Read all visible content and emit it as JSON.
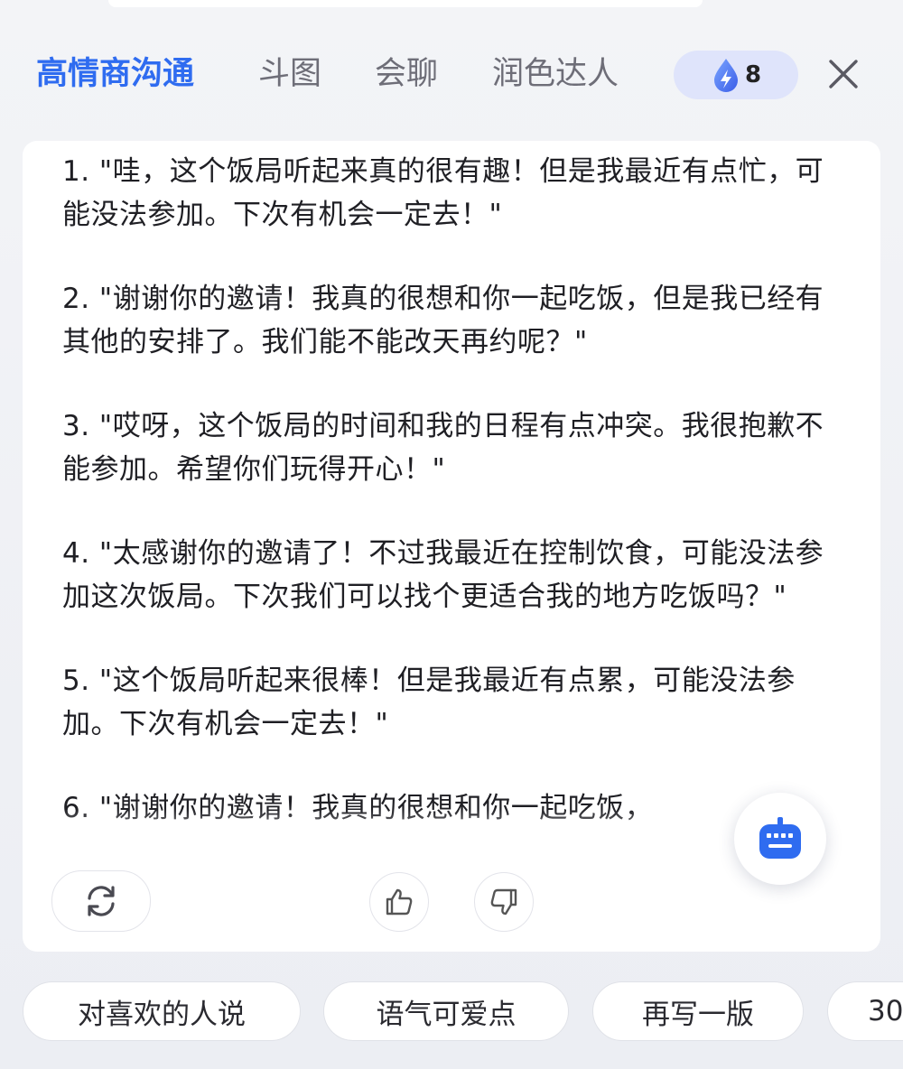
{
  "tabs": [
    {
      "label": "高情商沟通",
      "active": true
    },
    {
      "label": "斗图",
      "active": false
    },
    {
      "label": "会聊",
      "active": false
    },
    {
      "label": "润色达人",
      "active": false
    }
  ],
  "energy": {
    "icon": "lightning-drop-icon",
    "count": "8"
  },
  "close": {
    "icon": "close-icon"
  },
  "replies": [
    "1. \"哇，这个饭局听起来真的很有趣！但是我最近有点忙，可能没法参加。下次有机会一定去！\"",
    "2. \"谢谢你的邀请！我真的很想和你一起吃饭，但是我已经有其他的安排了。我们能不能改天再约呢？\"",
    "3. \"哎呀，这个饭局的时间和我的日程有点冲突。我很抱歉不能参加。希望你们玩得开心！\"",
    "4. \"太感谢你的邀请了！不过我最近在控制饮食，可能没法参加这次饭局。下次我们可以找个更适合我的地方吃饭吗？\"",
    "5. \"这个饭局听起来很棒！但是我最近有点累，可能没法参加。下次有机会一定去！\"",
    "6. \"谢谢你的邀请！我真的很想和你一起吃饭，"
  ],
  "actions": {
    "regenerate_icon": "refresh-icon",
    "like_icon": "thumbs-up-icon",
    "dislike_icon": "thumbs-down-icon",
    "keyboard_icon": "keyboard-icon"
  },
  "suggestions": [
    {
      "label": "对喜欢的人说"
    },
    {
      "label": "语气可爱点"
    },
    {
      "label": "再写一版"
    },
    {
      "label": "30"
    }
  ],
  "colors": {
    "accent": "#2f6cf0",
    "badge_bg": "#dfe4fb",
    "tab_inactive": "#6e6e78",
    "card_bg": "#ffffff"
  }
}
